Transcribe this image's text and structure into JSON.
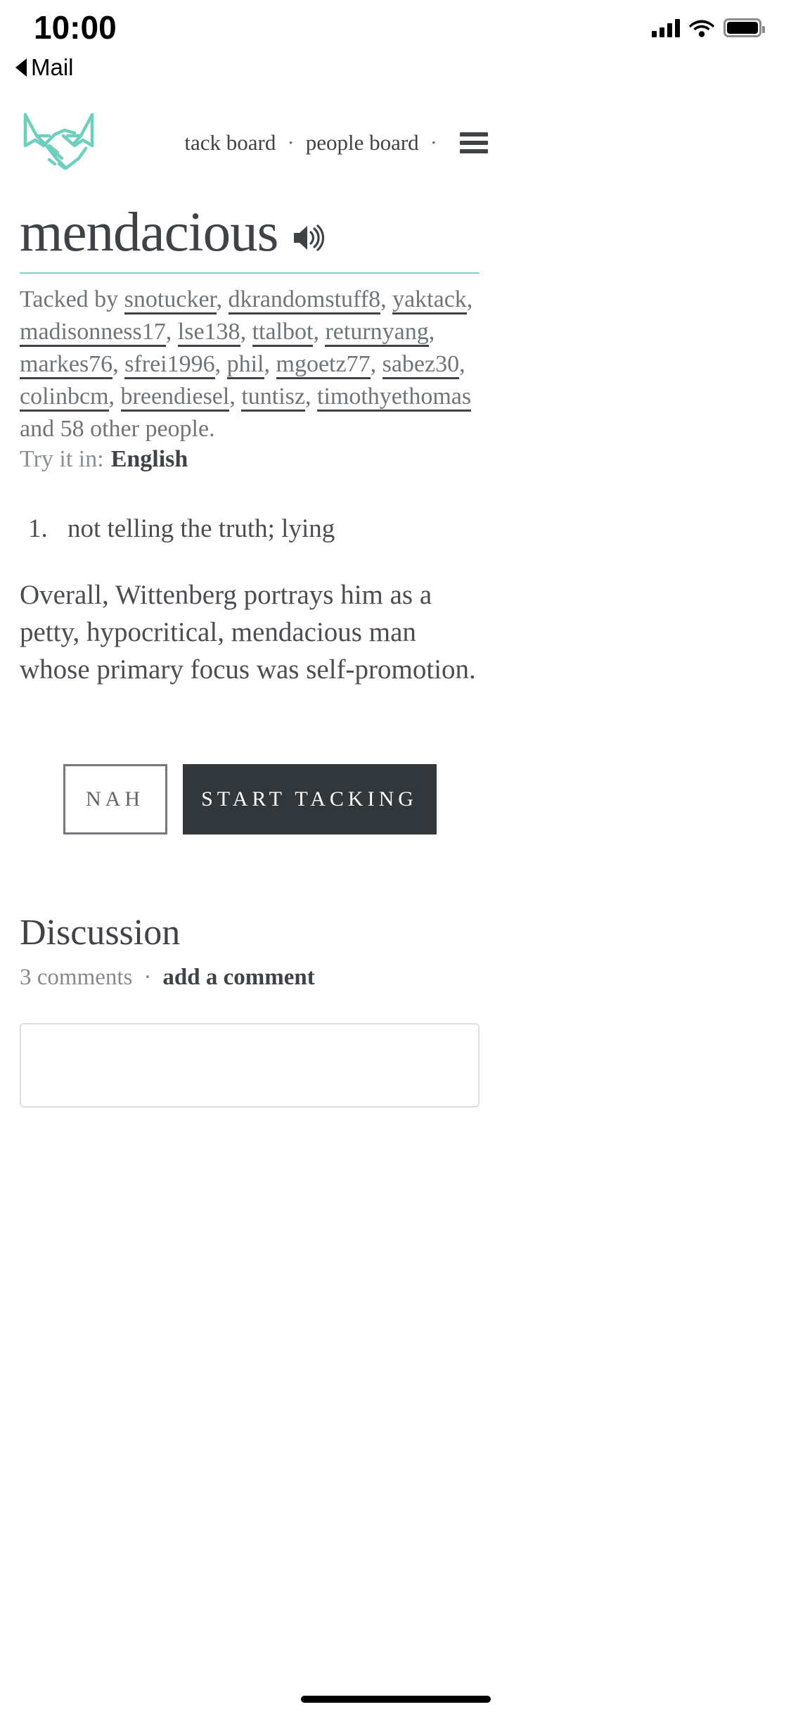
{
  "status_bar": {
    "time": "10:00",
    "back_label": "Mail",
    "back_icon": "triangle-left-icon",
    "signal_icon": "cellular-signal-icon",
    "wifi_icon": "wifi-icon",
    "battery_icon": "battery-full-icon"
  },
  "header": {
    "logo_icon": "handshake-logo-icon",
    "logo_color": "#6ecfbf",
    "nav": [
      {
        "label": "tack board"
      },
      {
        "label": "people board"
      }
    ],
    "separator": "·",
    "menu_icon": "hamburger-menu-icon"
  },
  "word_entry": {
    "word": "mendacious",
    "pronounce_icon": "speaker-sound-icon",
    "accent_color": "#7fd6c7",
    "tacked_prefix": "Tacked by ",
    "taggers": [
      "snotucker",
      "dkrandomstuff8",
      "yaktack",
      "madisonness17",
      "lse138",
      "ttalbot",
      "returnyang",
      "markes76",
      "sfrei1996",
      "phil",
      "mgoetz77",
      "sabez30",
      "colinbcm",
      "breendiesel",
      "tuntisz",
      "timothyethomas"
    ],
    "tacked_suffix": " and 58 other people.",
    "try_it_label": "Try it in:",
    "language": "English",
    "definitions": [
      {
        "number": "1.",
        "text": "not telling the truth; lying"
      }
    ],
    "example": "Overall, Wittenberg portrays him as a petty, hypocritical, mendacious man whose primary focus was self-promotion."
  },
  "actions": {
    "secondary_label": "NAH",
    "primary_label": "START TACKING"
  },
  "discussion": {
    "title": "Discussion",
    "comment_count": "3 comments",
    "separator": "·",
    "add_comment_label": "add a comment",
    "comment_input_placeholder": ""
  }
}
